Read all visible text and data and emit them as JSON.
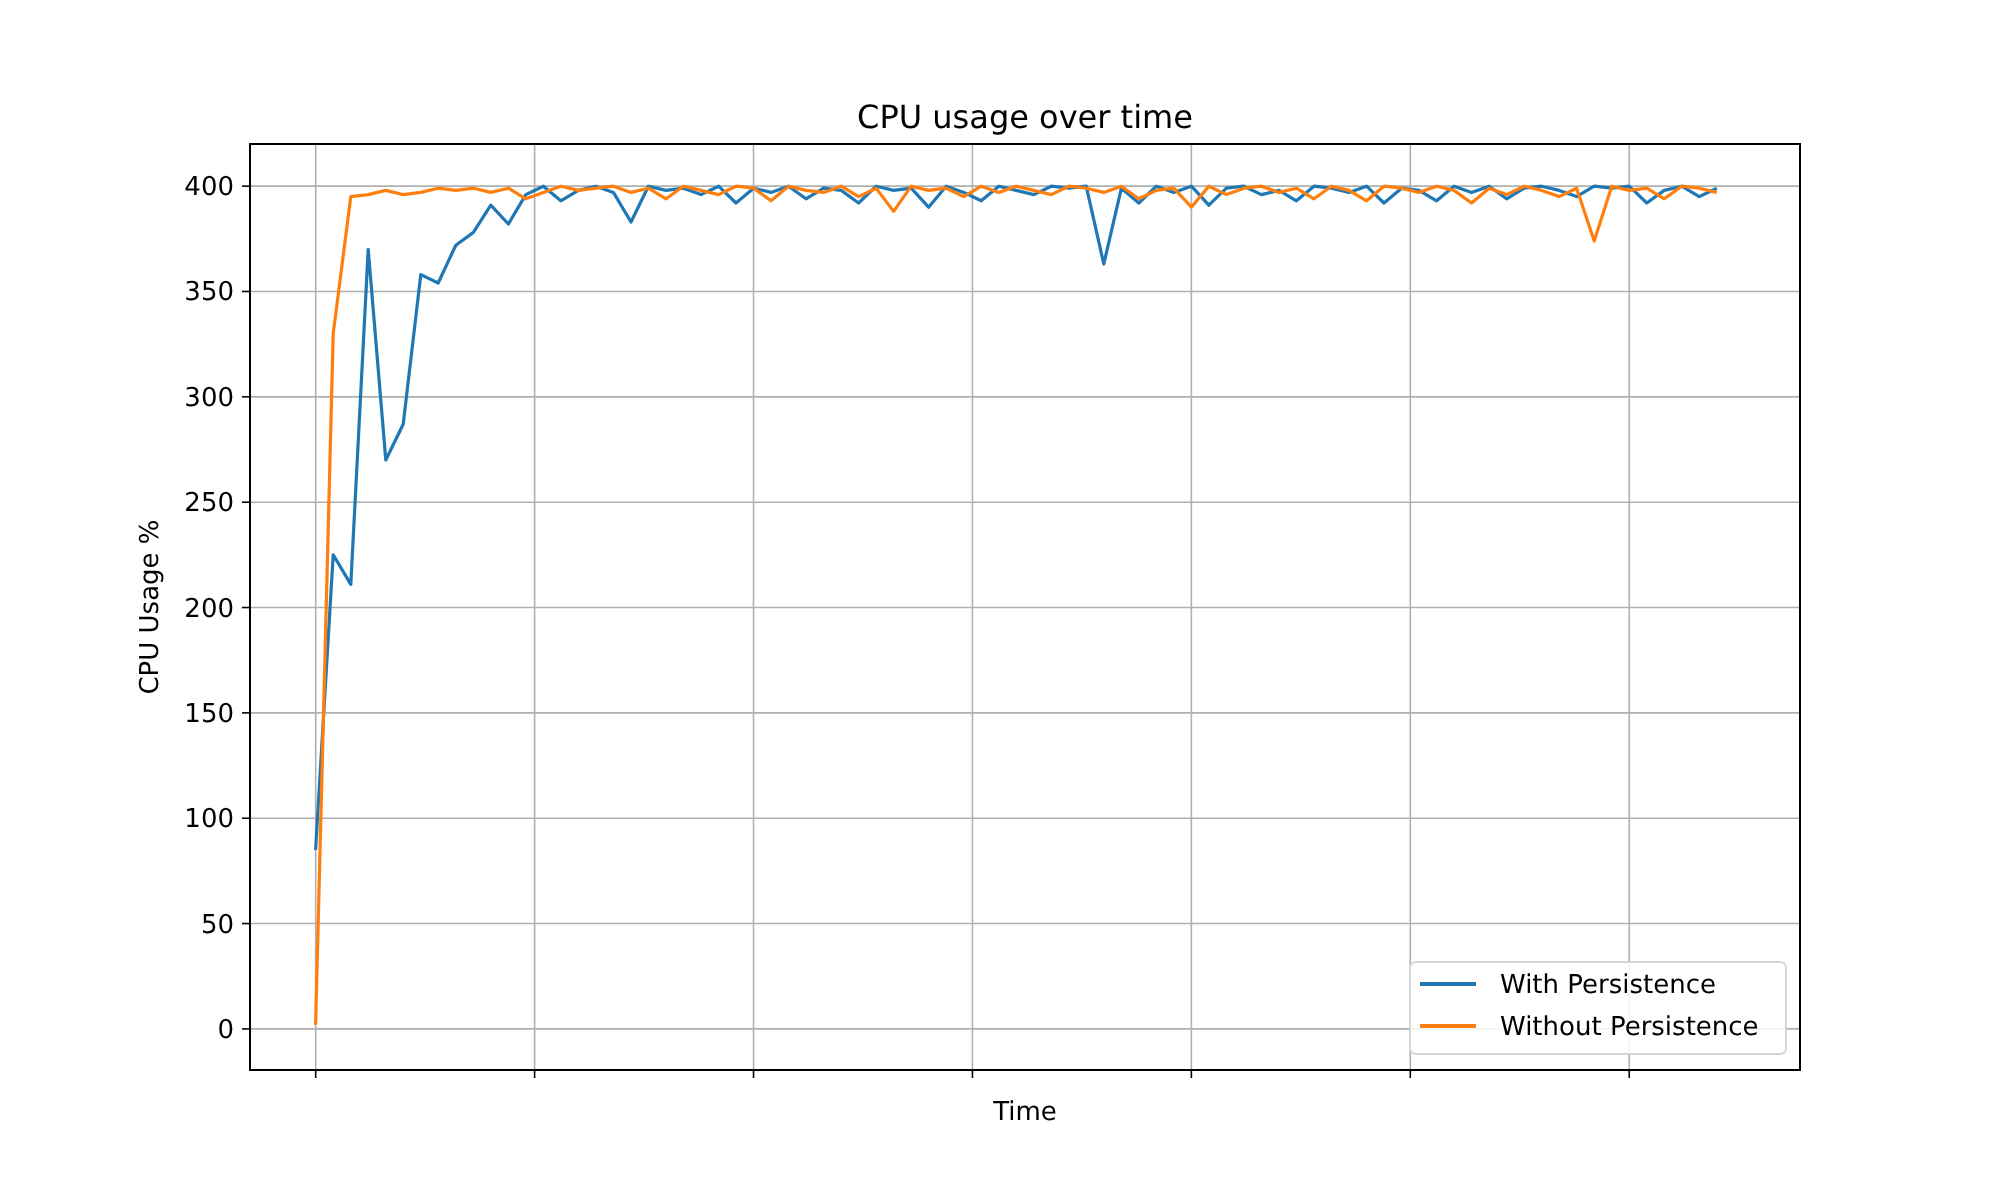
{
  "figure": {
    "chart_data": {
      "type": "line",
      "title": "CPU usage over time",
      "xlabel": "Time",
      "ylabel": "CPU Usage %",
      "categories": [
        null,
        null,
        null,
        null,
        null,
        null,
        null,
        null,
        null,
        null,
        null,
        null,
        null,
        null,
        null,
        null,
        null,
        null,
        null,
        null,
        null,
        null,
        null,
        null,
        null,
        null,
        null,
        null,
        null,
        null,
        null,
        null,
        null,
        null,
        null,
        null,
        null,
        null,
        null,
        null,
        null,
        null,
        null,
        null,
        null,
        null,
        null,
        null,
        null,
        null,
        null,
        null,
        null,
        null,
        null,
        null,
        null,
        null,
        null,
        null,
        null,
        null,
        null,
        null,
        null,
        null,
        null,
        null,
        null,
        null,
        null,
        null,
        null,
        null,
        null,
        null,
        null,
        null,
        null,
        null,
        null
      ],
      "series": [
        {
          "name": "With Persistence",
          "color": "#1f77b4",
          "values": [
            85,
            225,
            211,
            370,
            270,
            287,
            358,
            354,
            372,
            378,
            391,
            382,
            396,
            400,
            393,
            398,
            400,
            397,
            383,
            400,
            398,
            399,
            396,
            400,
            392,
            399,
            397,
            400,
            394,
            399,
            398,
            392,
            400,
            398,
            399,
            390,
            400,
            397,
            393,
            400,
            398,
            396,
            400,
            399,
            400,
            363,
            399,
            392,
            400,
            397,
            400,
            391,
            399,
            400,
            396,
            398,
            393,
            400,
            399,
            397,
            400,
            392,
            399,
            398,
            393,
            400,
            397,
            400,
            394,
            399,
            400,
            398,
            395,
            400,
            399,
            400,
            392,
            398,
            400,
            395,
            399
          ]
        },
        {
          "name": "Without Persistence",
          "color": "#ff7f0e",
          "values": [
            2,
            330,
            395,
            396,
            398,
            396,
            397,
            399,
            398,
            399,
            397,
            399,
            394,
            397,
            400,
            398,
            399,
            400,
            397,
            399,
            394,
            400,
            398,
            396,
            400,
            399,
            393,
            400,
            398,
            397,
            400,
            395,
            399,
            388,
            400,
            398,
            399,
            395,
            400,
            397,
            400,
            398,
            396,
            400,
            399,
            397,
            400,
            394,
            398,
            399,
            390,
            400,
            396,
            399,
            400,
            397,
            399,
            394,
            400,
            398,
            393,
            400,
            399,
            397,
            400,
            398,
            392,
            399,
            396,
            400,
            398,
            395,
            399,
            374,
            400,
            398,
            399,
            394,
            400,
            399,
            397
          ]
        }
      ],
      "grid": true,
      "legend": "lower right",
      "ylim": [
        -19.5,
        420
      ],
      "yticks": [
        0,
        50,
        100,
        150,
        200,
        250,
        300,
        350,
        400
      ]
    }
  }
}
